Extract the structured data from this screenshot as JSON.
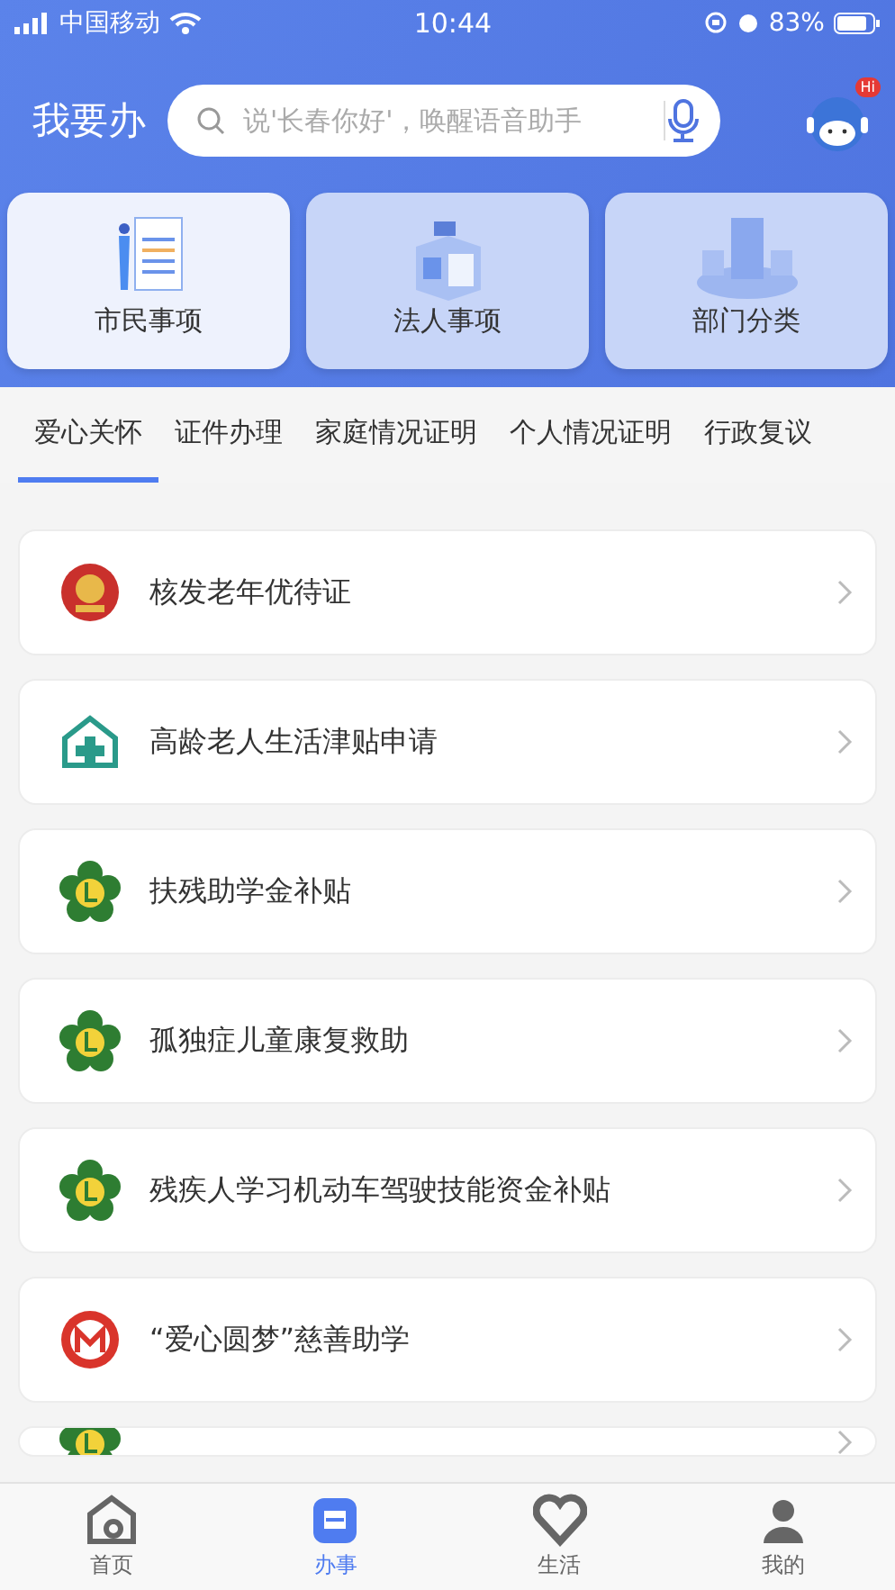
{
  "status_bar": {
    "carrier": "中国移动",
    "time": "10:44",
    "battery": "83%"
  },
  "header": {
    "title": "我要办",
    "search": {
      "placeholder": "说'长春你好'，唤醒语音助手"
    },
    "assistant_badge": "Hi"
  },
  "categories": [
    {
      "label": "市民事项",
      "selected": true,
      "kind": "citizen"
    },
    {
      "label": "法人事项",
      "selected": false,
      "kind": "company"
    },
    {
      "label": "部门分类",
      "selected": false,
      "kind": "department"
    }
  ],
  "tabs": [
    {
      "label": "爱心关怀",
      "selected": true
    },
    {
      "label": "证件办理",
      "selected": false
    },
    {
      "label": "家庭情况证明",
      "selected": false
    },
    {
      "label": "个人情况证明",
      "selected": false
    },
    {
      "label": "行政复议",
      "selected": false
    }
  ],
  "services": [
    {
      "title": "核发老年优待证",
      "kind": "emblem"
    },
    {
      "title": "高龄老人生活津贴申请",
      "kind": "care"
    },
    {
      "title": "扶残助学金补贴",
      "kind": "disability"
    },
    {
      "title": "孤独症儿童康复救助",
      "kind": "disability"
    },
    {
      "title": "残疾人学习机动车驾驶技能资金补贴",
      "kind": "disability"
    },
    {
      "title": "“爱心圆梦”慈善助学",
      "kind": "charity"
    },
    {
      "kind": "disability"
    }
  ],
  "bottom_nav": [
    {
      "label": "首页",
      "selected": false,
      "kind": "home"
    },
    {
      "label": "办事",
      "selected": true,
      "kind": "tasks"
    },
    {
      "label": "生活",
      "selected": false,
      "kind": "life"
    },
    {
      "label": "我的",
      "selected": false,
      "kind": "me"
    }
  ]
}
